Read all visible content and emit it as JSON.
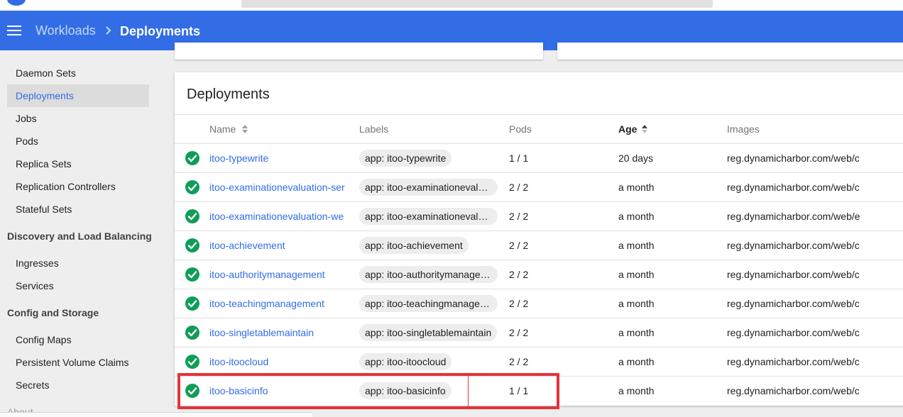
{
  "header": {
    "breadcrumb_parent": "Workloads",
    "breadcrumb_current": "Deployments"
  },
  "sidebar": {
    "items": [
      {
        "label": "Daemon Sets"
      },
      {
        "label": "Deployments",
        "active": true
      },
      {
        "label": "Jobs"
      },
      {
        "label": "Pods"
      },
      {
        "label": "Replica Sets"
      },
      {
        "label": "Replication Controllers"
      },
      {
        "label": "Stateful Sets"
      }
    ],
    "section_discovery": "Discovery and Load Balancing",
    "discovery_items": [
      {
        "label": "Ingresses"
      },
      {
        "label": "Services"
      }
    ],
    "section_config": "Config and Storage",
    "config_items": [
      {
        "label": "Config Maps"
      },
      {
        "label": "Persistent Volume Claims"
      },
      {
        "label": "Secrets"
      }
    ],
    "about": "About"
  },
  "deployments": {
    "title": "Deployments",
    "columns": {
      "name": "Name",
      "labels": "Labels",
      "pods": "Pods",
      "age": "Age",
      "images": "Images"
    },
    "sorted_column": "Age",
    "rows": [
      {
        "name": "itoo-typewrite",
        "label": "app: itoo-typewrite",
        "pods": "1 / 1",
        "age": "20 days",
        "image": "reg.dynamicharbor.com/web/c",
        "status": "running"
      },
      {
        "name": "itoo-examinationevaluation-ser",
        "label": "app: itoo-examinationevaluat…",
        "pods": "2 / 2",
        "age": "a month",
        "image": "reg.dynamicharbor.com/web/c",
        "status": "running"
      },
      {
        "name": "itoo-examinationevaluation-we",
        "label": "app: itoo-examinationevaluat…",
        "pods": "2 / 2",
        "age": "a month",
        "image": "reg.dynamicharbor.com/web/e",
        "status": "running"
      },
      {
        "name": "itoo-achievement",
        "label": "app: itoo-achievement",
        "pods": "2 / 2",
        "age": "a month",
        "image": "reg.dynamicharbor.com/web/c",
        "status": "running"
      },
      {
        "name": "itoo-authoritymanagement",
        "label": "app: itoo-authoritymanagem…",
        "pods": "2 / 2",
        "age": "a month",
        "image": "reg.dynamicharbor.com/web/c",
        "status": "running"
      },
      {
        "name": "itoo-teachingmanagement",
        "label": "app: itoo-teachingmanagem…",
        "pods": "2 / 2",
        "age": "a month",
        "image": "reg.dynamicharbor.com/web/c",
        "status": "running"
      },
      {
        "name": "itoo-singletablemaintain",
        "label": "app: itoo-singletablemaintain",
        "pods": "2 / 2",
        "age": "a month",
        "image": "reg.dynamicharbor.com/web/c",
        "status": "running"
      },
      {
        "name": "itoo-itoocloud",
        "label": "app: itoo-itoocloud",
        "pods": "2 / 2",
        "age": "a month",
        "image": "reg.dynamicharbor.com/web/c",
        "status": "running"
      },
      {
        "name": "itoo-basicinfo",
        "label": "app: itoo-basicinfo",
        "pods": "1 / 1",
        "age": "a month",
        "image": "reg.dynamicharbor.com/web/c",
        "status": "running"
      }
    ]
  },
  "colors": {
    "primary": "#326de6",
    "status_ok": "#0f9d58",
    "highlight": "#e53238"
  },
  "icons": {
    "menu": "menu-icon",
    "breadcrumb_separator": "chevron-right-icon",
    "sort": "sort-icon",
    "status": "check-circle-icon"
  }
}
